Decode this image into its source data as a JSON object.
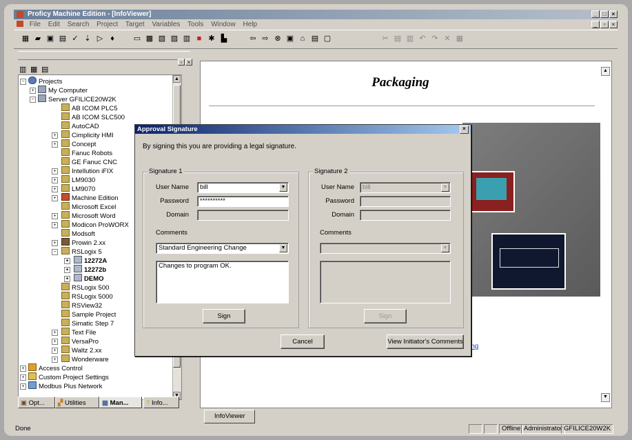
{
  "app": {
    "title": "Proficy Machine Edition - [InfoViewer]"
  },
  "menu": [
    "File",
    "Edit",
    "Search",
    "Project",
    "Target",
    "Variables",
    "Tools",
    "Window",
    "Help"
  ],
  "tree": {
    "items": [
      {
        "label": "Projects",
        "indent": 0
      },
      {
        "label": "My Computer",
        "indent": 1
      },
      {
        "label": "Server GFILICE20W2K",
        "indent": 1
      },
      {
        "label": "AB ICOM PLC5",
        "indent": 2
      },
      {
        "label": "AB ICOM SLC500",
        "indent": 2
      },
      {
        "label": "AutoCAD",
        "indent": 2
      },
      {
        "label": "Cimplicity HMI",
        "indent": 2
      },
      {
        "label": "Concept",
        "indent": 2
      },
      {
        "label": "Fanuc Robots",
        "indent": 2
      },
      {
        "label": "GE Fanuc CNC",
        "indent": 2
      },
      {
        "label": "Intellution iFIX",
        "indent": 2
      },
      {
        "label": "LM9030",
        "indent": 2
      },
      {
        "label": "LM9070",
        "indent": 2
      },
      {
        "label": "Machine Edition",
        "indent": 2
      },
      {
        "label": "Microsoft Excel",
        "indent": 2
      },
      {
        "label": "Microsoft Word",
        "indent": 2
      },
      {
        "label": "Modicon ProWORX",
        "indent": 2
      },
      {
        "label": "Modsoft",
        "indent": 2
      },
      {
        "label": "Prowin 2.xx",
        "indent": 2
      },
      {
        "label": "RSLogix 5",
        "indent": 2
      },
      {
        "label": "12272A",
        "indent": 3,
        "bold": true
      },
      {
        "label": "12272b",
        "indent": 3,
        "bold": true
      },
      {
        "label": "DEMO",
        "indent": 3,
        "bold": true
      },
      {
        "label": "RSLogix 500",
        "indent": 2
      },
      {
        "label": "RSLogix 5000",
        "indent": 2
      },
      {
        "label": "RSView32",
        "indent": 2
      },
      {
        "label": "Sample Project",
        "indent": 2
      },
      {
        "label": "Simatic Step 7",
        "indent": 2
      },
      {
        "label": "Text File",
        "indent": 2
      },
      {
        "label": "VersaPro",
        "indent": 2
      },
      {
        "label": "Waltz 2.xx",
        "indent": 2
      },
      {
        "label": "Wonderware",
        "indent": 2
      },
      {
        "label": "Access Control",
        "indent": 0
      },
      {
        "label": "Custom Project Settings",
        "indent": 0
      },
      {
        "label": "Modbus Plus Network",
        "indent": 0
      }
    ]
  },
  "panel_tabs": [
    "Opt...",
    "Utilities",
    "Man...",
    "Info..."
  ],
  "infoviewer": {
    "heading": "Packaging",
    "link": "ing",
    "tab": "InfoViewer"
  },
  "dialog": {
    "title": "Approval Signature",
    "intro": "By signing this you are providing a legal signature.",
    "sig1": {
      "group": "Signature 1",
      "user_label": "User Name",
      "user_value": "bill",
      "password_label": "Password",
      "password_value": "**********",
      "domain_label": "Domain",
      "domain_value": "",
      "comments_label": "Comments",
      "comment_type": "Standard Engineering Change",
      "comment_text": "Changes to program OK.",
      "sign_label": "Sign"
    },
    "sig2": {
      "group": "Signature 2",
      "user_label": "User Name",
      "user_value": "bill",
      "password_label": "Password",
      "domain_label": "Domain",
      "comments_label": "Comments",
      "sign_label": "Sign"
    },
    "cancel_label": "Cancel",
    "view_comments_label": "View Initiator's Comments"
  },
  "status": {
    "left": "Done",
    "mode": "Offline",
    "user": "Administrator",
    "server": "GFILICE20W2K"
  },
  "colors": {
    "titlebar": "#6a7e99",
    "dialog_titlebar": "#0a246a",
    "window_bg": "#d4d0c8"
  }
}
